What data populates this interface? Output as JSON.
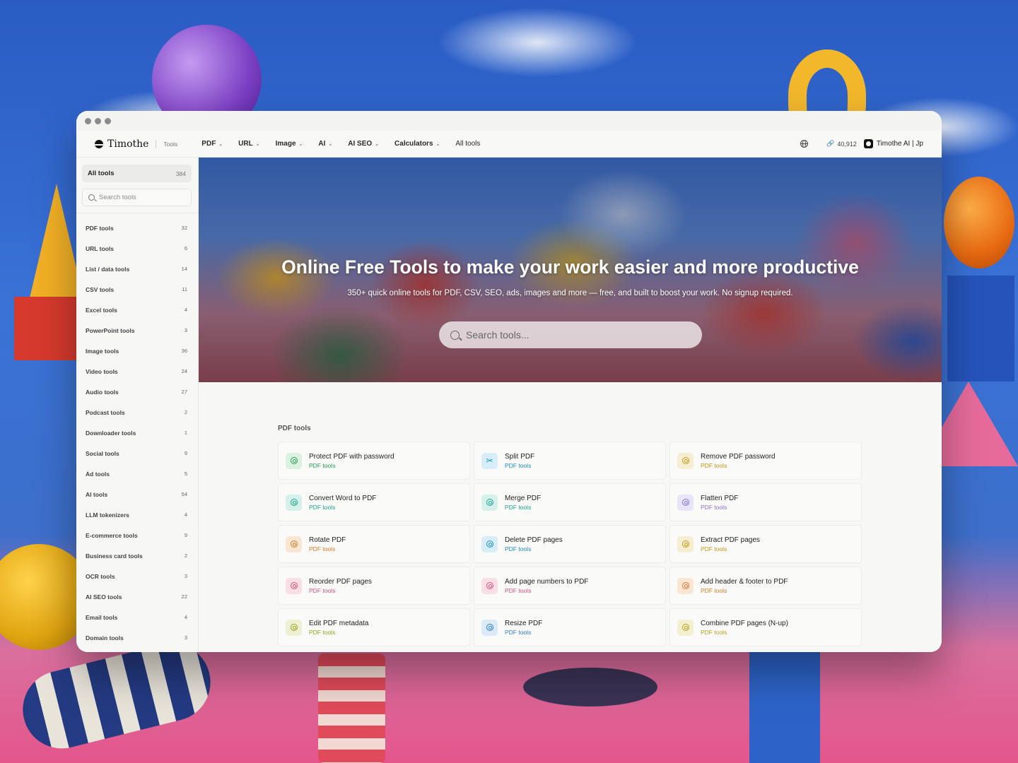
{
  "header": {
    "brand_name": "Timothe",
    "brand_sub": "Tools",
    "nav": [
      {
        "label": "PDF",
        "dropdown": true
      },
      {
        "label": "URL",
        "dropdown": true
      },
      {
        "label": "Image",
        "dropdown": true
      },
      {
        "label": "AI",
        "dropdown": true
      },
      {
        "label": "AI SEO",
        "dropdown": true
      },
      {
        "label": "Calculators",
        "dropdown": true
      },
      {
        "label": "All tools",
        "dropdown": false
      }
    ],
    "count": "40,912",
    "user_label": "Timothe AI | Jp"
  },
  "sidebar": {
    "all_label": "All tools",
    "all_count": "384",
    "search_placeholder": "Search tools",
    "items": [
      {
        "label": "PDF tools",
        "count": "32"
      },
      {
        "label": "URL tools",
        "count": "6"
      },
      {
        "label": "List / data tools",
        "count": "14"
      },
      {
        "label": "CSV tools",
        "count": "11"
      },
      {
        "label": "Excel tools",
        "count": "4"
      },
      {
        "label": "PowerPoint tools",
        "count": "3"
      },
      {
        "label": "Image tools",
        "count": "36"
      },
      {
        "label": "Video tools",
        "count": "24"
      },
      {
        "label": "Audio tools",
        "count": "27"
      },
      {
        "label": "Podcast tools",
        "count": "2"
      },
      {
        "label": "Downloader tools",
        "count": "1"
      },
      {
        "label": "Social tools",
        "count": "9"
      },
      {
        "label": "Ad tools",
        "count": "5"
      },
      {
        "label": "AI tools",
        "count": "54"
      },
      {
        "label": "LLM tokenizers",
        "count": "4"
      },
      {
        "label": "E-commerce tools",
        "count": "9"
      },
      {
        "label": "Business card tools",
        "count": "2"
      },
      {
        "label": "OCR tools",
        "count": "3"
      },
      {
        "label": "AI SEO tools",
        "count": "22"
      },
      {
        "label": "Email tools",
        "count": "4"
      },
      {
        "label": "Domain tools",
        "count": "3"
      }
    ]
  },
  "hero": {
    "title": "Online Free Tools to make your work easier and more productive",
    "subtitle": "350+ quick online tools for PDF, CSV, SEO, ads, images and more — free, and built to boost your work. No signup required.",
    "search_placeholder": "Search tools..."
  },
  "section": {
    "title": "PDF tools",
    "tools": [
      {
        "name": "Protect PDF with password",
        "category": "PDF tools",
        "color": "green",
        "icon": "shield-icon"
      },
      {
        "name": "Split PDF",
        "category": "PDF tools",
        "color": "cyan",
        "icon": "scissors-icon"
      },
      {
        "name": "Remove PDF password",
        "category": "PDF tools",
        "color": "yellow",
        "icon": "unlock-icon"
      },
      {
        "name": "Convert Word to PDF",
        "category": "PDF tools",
        "color": "teal",
        "icon": "convert-icon"
      },
      {
        "name": "Merge PDF",
        "category": "PDF tools",
        "color": "teal",
        "icon": "merge-icon"
      },
      {
        "name": "Flatten PDF",
        "category": "PDF tools",
        "color": "purple",
        "icon": "layers-icon"
      },
      {
        "name": "Rotate PDF",
        "category": "PDF tools",
        "color": "orange",
        "icon": "rotate-icon"
      },
      {
        "name": "Delete PDF pages",
        "category": "PDF tools",
        "color": "cyan",
        "icon": "trash-icon"
      },
      {
        "name": "Extract PDF pages",
        "category": "PDF tools",
        "color": "yellow",
        "icon": "extract-icon"
      },
      {
        "name": "Reorder PDF pages",
        "category": "PDF tools",
        "color": "pink",
        "icon": "reorder-icon"
      },
      {
        "name": "Add page numbers to PDF",
        "category": "PDF tools",
        "color": "pink",
        "icon": "hash-icon"
      },
      {
        "name": "Add header & footer to PDF",
        "category": "PDF tools",
        "color": "orange",
        "icon": "header-icon"
      },
      {
        "name": "Edit PDF metadata",
        "category": "PDF tools",
        "color": "olive",
        "icon": "edit-icon"
      },
      {
        "name": "Resize PDF",
        "category": "PDF tools",
        "color": "blue",
        "icon": "resize-icon"
      },
      {
        "name": "Combine PDF pages (N-up)",
        "category": "PDF tools",
        "color": "gold",
        "icon": "grid-icon"
      }
    ]
  }
}
